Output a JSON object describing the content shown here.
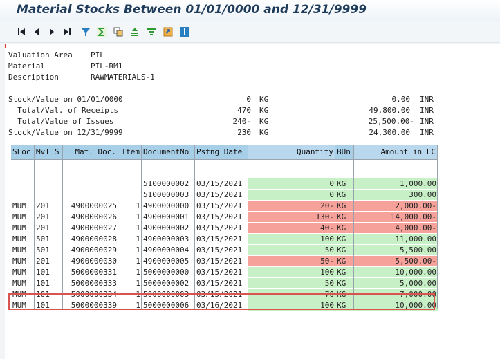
{
  "title": "Material Stocks Between 01/01/0000 and 12/31/9999",
  "toolbar": [
    "first-page-icon",
    "previous-page-icon",
    "next-page-icon",
    "last-page-icon",
    "filter-icon",
    "sum-icon",
    "layout-icon",
    "sort-ascending-icon",
    "filter-settings-icon",
    "export-icon",
    "info-icon"
  ],
  "header": {
    "valuation_area_label": "Valuation Area",
    "valuation_area_value": "PIL",
    "material_label": "Material",
    "material_value": "PIL-RM1",
    "description_label": "Description",
    "description_value": "RAWMATERIALS-1"
  },
  "summary": [
    {
      "label": "Stock/Value on 01/01/0000",
      "qty": "0",
      "unit": "KG",
      "amount": "0.00",
      "currency": "INR"
    },
    {
      "label": "  Total/Val. of Receipts",
      "qty": "470",
      "unit": "KG",
      "amount": "49,800.00",
      "currency": "INR"
    },
    {
      "label": "  Total/Value of Issues",
      "qty": "240-",
      "unit": "KG",
      "amount": "25,500.00-",
      "currency": "INR"
    },
    {
      "label": "Stock/Value on 12/31/9999",
      "qty": "230",
      "unit": "KG",
      "amount": "24,300.00",
      "currency": "INR"
    }
  ],
  "table": {
    "columns": [
      "SLoc",
      "MvT",
      "S",
      "Mat. Doc.",
      "Item",
      "DocumentNo",
      "Pstng Date",
      "Quantity",
      "BUn",
      "Amount in LC"
    ],
    "rows": [
      {
        "sloc": "",
        "mvt": "",
        "s": "",
        "matdoc": "",
        "item": "",
        "docno": "",
        "date": "",
        "qty": "",
        "bun": "",
        "amount": "",
        "status": "none"
      },
      {
        "sloc": "",
        "mvt": "",
        "s": "",
        "matdoc": "",
        "item": "",
        "docno": "5100000002",
        "date": "03/15/2021",
        "qty": "0",
        "bun": "KG",
        "amount": "1,000.00",
        "status": "green"
      },
      {
        "sloc": "",
        "mvt": "",
        "s": "",
        "matdoc": "",
        "item": "",
        "docno": "5100000003",
        "date": "03/15/2021",
        "qty": "0",
        "bun": "KG",
        "amount": "300.00",
        "status": "green"
      },
      {
        "sloc": "MUM",
        "mvt": "201",
        "s": "",
        "matdoc": "4900000025",
        "item": "1",
        "docno": "4900000000",
        "date": "03/15/2021",
        "qty": "20-",
        "bun": "KG",
        "amount": "2,000.00-",
        "status": "red"
      },
      {
        "sloc": "MUM",
        "mvt": "201",
        "s": "",
        "matdoc": "4900000026",
        "item": "1",
        "docno": "4900000001",
        "date": "03/15/2021",
        "qty": "130-",
        "bun": "KG",
        "amount": "14,000.00-",
        "status": "red"
      },
      {
        "sloc": "MUM",
        "mvt": "201",
        "s": "",
        "matdoc": "4900000027",
        "item": "1",
        "docno": "4900000002",
        "date": "03/15/2021",
        "qty": "40-",
        "bun": "KG",
        "amount": "4,000.00-",
        "status": "red"
      },
      {
        "sloc": "MUM",
        "mvt": "501",
        "s": "",
        "matdoc": "4900000028",
        "item": "1",
        "docno": "4900000003",
        "date": "03/15/2021",
        "qty": "100",
        "bun": "KG",
        "amount": "11,000.00",
        "status": "green"
      },
      {
        "sloc": "MUM",
        "mvt": "501",
        "s": "",
        "matdoc": "4900000029",
        "item": "1",
        "docno": "4900000004",
        "date": "03/15/2021",
        "qty": "50",
        "bun": "KG",
        "amount": "5,500.00",
        "status": "green"
      },
      {
        "sloc": "MUM",
        "mvt": "201",
        "s": "",
        "matdoc": "4900000030",
        "item": "1",
        "docno": "4900000005",
        "date": "03/15/2021",
        "qty": "50-",
        "bun": "KG",
        "amount": "5,500.00-",
        "status": "red"
      },
      {
        "sloc": "MUM",
        "mvt": "101",
        "s": "",
        "matdoc": "5000000331",
        "item": "1",
        "docno": "5000000000",
        "date": "03/15/2021",
        "qty": "100",
        "bun": "KG",
        "amount": "10,000.00",
        "status": "green"
      },
      {
        "sloc": "MUM",
        "mvt": "101",
        "s": "",
        "matdoc": "5000000333",
        "item": "1",
        "docno": "5000000002",
        "date": "03/15/2021",
        "qty": "50",
        "bun": "KG",
        "amount": "5,000.00",
        "status": "green"
      },
      {
        "sloc": "MUM",
        "mvt": "101",
        "s": "",
        "matdoc": "5000000334",
        "item": "1",
        "docno": "5000000003",
        "date": "03/15/2021",
        "qty": "70",
        "bun": "KG",
        "amount": "7,000.00",
        "status": "green"
      },
      {
        "sloc": "MUM",
        "mvt": "101",
        "s": "",
        "matdoc": "5000000339",
        "item": "1",
        "docno": "5000000006",
        "date": "03/16/2021",
        "qty": "100",
        "bun": "KG",
        "amount": "10,000.00",
        "status": "green"
      }
    ]
  },
  "colors": {
    "green": "#c8f0c6",
    "red": "#f6a19a",
    "header": "#a8cfe8",
    "highlight": "#d9534f"
  }
}
